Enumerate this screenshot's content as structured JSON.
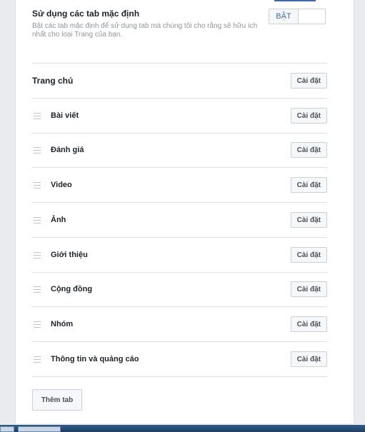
{
  "default_tabs": {
    "title": "Sử dụng các tab mặc định",
    "description": "Bật các tab mặc định để sử dụng tab mà chúng tôi cho rằng sẽ hữu ích nhất cho loại Trang của bạn.",
    "toggle_on_label": "BẬT"
  },
  "tabs": [
    {
      "label": "Trang chủ",
      "button": "Cài đặt",
      "draggable": false
    },
    {
      "label": "Bài viết",
      "button": "Cài đặt",
      "draggable": true
    },
    {
      "label": "Đánh giá",
      "button": "Cài đặt",
      "draggable": true
    },
    {
      "label": "Video",
      "button": "Cài đặt",
      "draggable": true
    },
    {
      "label": "Ảnh",
      "button": "Cài đặt",
      "draggable": true
    },
    {
      "label": "Giới thiệu",
      "button": "Cài đặt",
      "draggable": true
    },
    {
      "label": "Cộng đồng",
      "button": "Cài đặt",
      "draggable": true
    },
    {
      "label": "Nhóm",
      "button": "Cài đặt",
      "draggable": true
    },
    {
      "label": "Thông tin và quảng cáo",
      "button": "Cài đặt",
      "draggable": true
    }
  ],
  "add_tab_label": "Thêm tab",
  "colors": {
    "accent": "#4267b2",
    "border": "#dddfe2",
    "button_bg": "#f6f7f9"
  }
}
